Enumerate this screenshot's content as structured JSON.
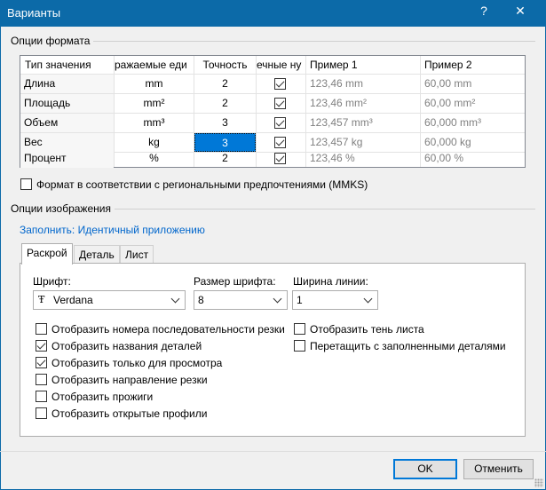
{
  "window": {
    "title": "Варианты",
    "help": "?",
    "close": "✕"
  },
  "format_group": {
    "title": "Опции формата",
    "headers": [
      "Тип значения",
      "ражаемые еди",
      "Точность",
      "ечные ну",
      "Пример 1",
      "Пример 2"
    ],
    "rows": [
      {
        "type": "Длина",
        "unit": "mm",
        "precision": "2",
        "checked": true,
        "ex1": "123,46 mm",
        "ex2": "60,00 mm"
      },
      {
        "type": "Площадь",
        "unit": "mm²",
        "precision": "2",
        "checked": true,
        "ex1": "123,46 mm²",
        "ex2": "60,00 mm²"
      },
      {
        "type": "Объем",
        "unit": "mm³",
        "precision": "3",
        "checked": true,
        "ex1": "123,457 mm³",
        "ex2": "60,000 mm³"
      },
      {
        "type": "Вес",
        "unit": "kg",
        "precision": "3",
        "checked": true,
        "ex1": "123,457 kg",
        "ex2": "60,000 kg"
      },
      {
        "type": "Процент",
        "unit": "%",
        "precision": "2",
        "checked": true,
        "ex1": "123,46 %",
        "ex2": "60,00 %"
      }
    ],
    "regional_checkbox": {
      "label": "Формат в соответствии с региональными предпочтениями (MMKS)",
      "checked": false
    }
  },
  "image_group": {
    "title": "Опции изображения",
    "fill_link": "Заполнить: Идентичный приложению",
    "tabs": [
      "Раскрой",
      "Деталь",
      "Лист"
    ],
    "active_tab": "Раскрой",
    "font_label": "Шрифт:",
    "font_value": "Verdana",
    "font_size_label": "Размер шрифта:",
    "font_size_value": "8",
    "line_width_label": "Ширина линии:",
    "line_width_value": "1",
    "options_left": [
      {
        "label": "Отобразить номера последовательности резки",
        "checked": false
      },
      {
        "label": "Отобразить названия деталей",
        "checked": true
      },
      {
        "label": "Отобразить только для просмотра",
        "checked": true
      },
      {
        "label": "Отобразить направление резки",
        "checked": false
      },
      {
        "label": "Отобразить прожиги",
        "checked": false
      },
      {
        "label": "Отобразить открытые профили",
        "checked": false
      }
    ],
    "options_right": [
      {
        "label": "Отобразить тень листа",
        "checked": false
      },
      {
        "label": "Перетащить с заполненными деталями",
        "checked": false
      }
    ]
  },
  "buttons": {
    "ok": "OK",
    "cancel": "Отменить"
  },
  "colors": {
    "titlebar": "#0c6aa8",
    "selection": "#0078d7",
    "link": "#0066cc"
  },
  "icons": [
    "font-icon",
    "chevron-down-icon",
    "checkmark-icon",
    "close-icon",
    "help-icon",
    "resize-grip-icon"
  ]
}
